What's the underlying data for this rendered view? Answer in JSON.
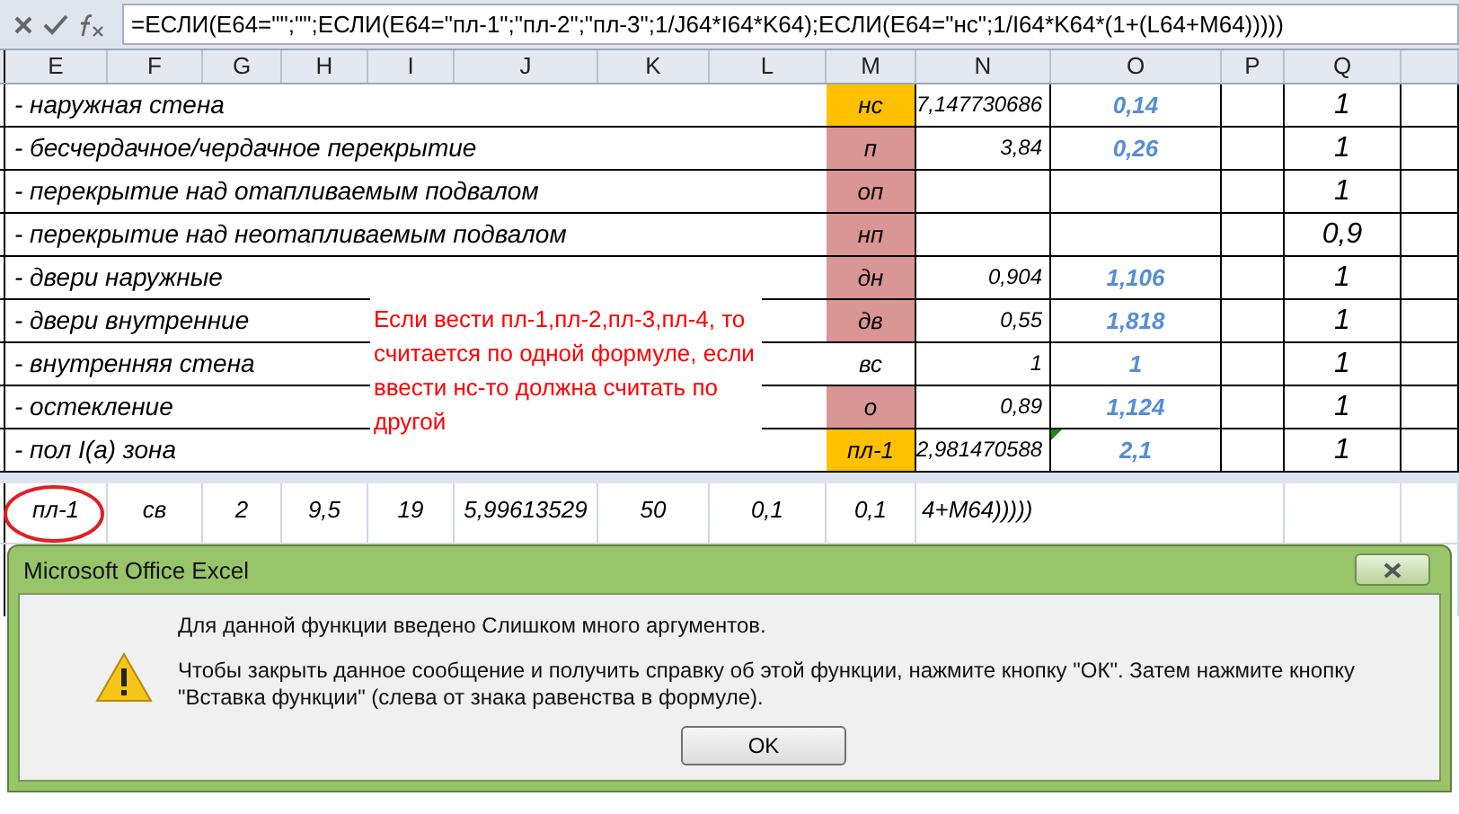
{
  "formula_bar": {
    "formula": "=ЕСЛИ(E64=\"\";\"\";ЕСЛИ(E64=\"пл-1\";\"пл-2\";\"пл-3\";1/J64*I64*K64);ЕСЛИ(E64=\"нс\";1/I64*K64*(1+(L64+M64)))))"
  },
  "columns": [
    "E",
    "F",
    "G",
    "H",
    "I",
    "J",
    "K",
    "L",
    "M",
    "N",
    "O",
    "P",
    "Q"
  ],
  "rows": [
    {
      "label": "- наружная стена",
      "code": "нс",
      "color": "#ffc000",
      "n": "7,147730686",
      "o": "0,14",
      "q": "1"
    },
    {
      "label": "- бесчердачное/чердачное перекрытие",
      "code": "п",
      "color": "#da9694",
      "n": "3,84",
      "o": "0,26",
      "q": "1"
    },
    {
      "label": "- перекрытие над отапливаемым подвалом",
      "code": "оп",
      "color": "#da9694",
      "n": "",
      "o": "",
      "q": "1"
    },
    {
      "label": "- перекрытие над неотапливаемым подвалом",
      "code": "нп",
      "color": "#da9694",
      "n": "",
      "o": "",
      "q": "0,9"
    },
    {
      "label": "- двери наружные",
      "code": "дн",
      "color": "#da9694",
      "n": "0,904",
      "o": "1,106",
      "q": "1"
    },
    {
      "label": "- двери внутренние",
      "code": "дв",
      "color": "#da9694",
      "n": "0,55",
      "o": "1,818",
      "q": "1"
    },
    {
      "label": "- внутренняя стена",
      "code": "вс",
      "color": "#ffffff",
      "n": "1",
      "o": "1",
      "q": "1"
    },
    {
      "label": "- остекление",
      "code": "о",
      "color": "#da9694",
      "n": "0,89",
      "o": "1,124",
      "q": "1"
    },
    {
      "label": "- пол I(а) зона",
      "code": "пл-1",
      "color": "#ffc000",
      "n": "2,981470588",
      "o": "2,1",
      "q": "1"
    }
  ],
  "note": "Если вести пл-1,пл-2,пл-3,пл-4, то считается по одной формуле, если ввести нс-то должна считать по другой",
  "lower_row": [
    "пл-1",
    "св",
    "2",
    "9,5",
    "19",
    "5,99613529",
    "50",
    "0,1",
    "0,1"
  ],
  "lower_overflow": "4+M64)))))",
  "dialog": {
    "title": "Microsoft Office Excel",
    "messages": [
      "Для данной функции введено Слишком много аргументов.",
      "Чтобы закрыть данное сообщение и получить справку об этой функции, нажмите кнопку \"ОК\". Затем нажмите кнопку \"Вставка функции\" (слева от знака равенства в формуле)."
    ],
    "button": "OK"
  }
}
